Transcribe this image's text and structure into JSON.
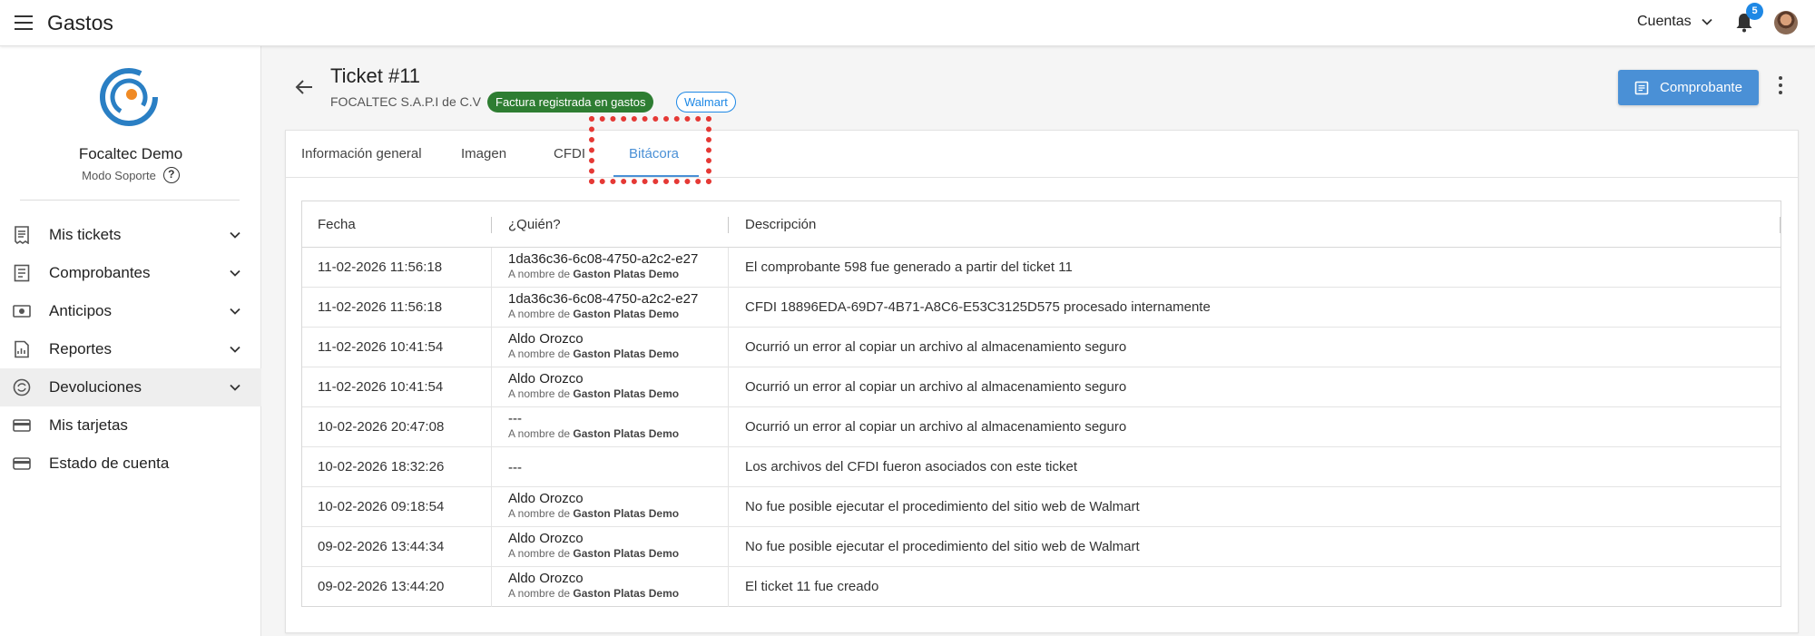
{
  "app": {
    "title": "Gastos"
  },
  "topbar": {
    "accounts_label": "Cuentas",
    "notifications_count": "5"
  },
  "sidebar": {
    "org_name": "Focaltec Demo",
    "org_mode": "Modo Soporte",
    "items": [
      {
        "label": "Mis tickets",
        "icon": "receipt-icon",
        "expandable": true
      },
      {
        "label": "Comprobantes",
        "icon": "document-icon",
        "expandable": true
      },
      {
        "label": "Anticipos",
        "icon": "cash-icon",
        "expandable": true
      },
      {
        "label": "Reportes",
        "icon": "report-icon",
        "expandable": true
      },
      {
        "label": "Devoluciones",
        "icon": "refund-icon",
        "expandable": true
      },
      {
        "label": "Mis tarjetas",
        "icon": "card-icon",
        "expandable": false
      },
      {
        "label": "Estado de cuenta",
        "icon": "wallet-icon",
        "expandable": false
      }
    ]
  },
  "ticket": {
    "title": "Ticket #11",
    "company": "FOCALTEC S.A.P.I de C.V",
    "status_badge": "Factura registrada en gastos",
    "store_badge": "Walmart",
    "comprobante_button": "Comprobante"
  },
  "tabs": [
    "Información general",
    "Imagen",
    "CFDI",
    "Bitácora"
  ],
  "log": {
    "headers": {
      "date": "Fecha",
      "who": "¿Quién?",
      "desc": "Descripción"
    },
    "on_behalf_prefix": "A nombre de",
    "rows": [
      {
        "date": "11-02-2026 11:56:18",
        "who": "1da36c36-6c08-4750-a2c2-e27",
        "on_behalf": "Gaston Platas Demo",
        "desc": "El comprobante 598 fue generado a partir del ticket 11"
      },
      {
        "date": "11-02-2026 11:56:18",
        "who": "1da36c36-6c08-4750-a2c2-e27",
        "on_behalf": "Gaston Platas Demo",
        "desc": "CFDI 18896EDA-69D7-4B71-A8C6-E53C3125D575 procesado internamente"
      },
      {
        "date": "11-02-2026 10:41:54",
        "who": "Aldo Orozco",
        "on_behalf": "Gaston Platas Demo",
        "desc": "Ocurrió un error al copiar un archivo al almacenamiento seguro"
      },
      {
        "date": "11-02-2026 10:41:54",
        "who": "Aldo Orozco",
        "on_behalf": "Gaston Platas Demo",
        "desc": "Ocurrió un error al copiar un archivo al almacenamiento seguro"
      },
      {
        "date": "10-02-2026 20:47:08",
        "who": "---",
        "on_behalf": "Gaston Platas Demo",
        "desc": "Ocurrió un error al copiar un archivo al almacenamiento seguro"
      },
      {
        "date": "10-02-2026 18:32:26",
        "who": "---",
        "on_behalf": "",
        "desc": "Los archivos del CFDI fueron asociados con este ticket"
      },
      {
        "date": "10-02-2026 09:18:54",
        "who": "Aldo Orozco",
        "on_behalf": "Gaston Platas Demo",
        "desc": "No fue posible ejecutar el procedimiento del sitio web de Walmart"
      },
      {
        "date": "09-02-2026 13:44:34",
        "who": "Aldo Orozco",
        "on_behalf": "Gaston Platas Demo",
        "desc": "No fue posible ejecutar el procedimiento del sitio web de Walmart"
      },
      {
        "date": "09-02-2026 13:44:20",
        "who": "Aldo Orozco",
        "on_behalf": "Gaston Platas Demo",
        "desc": "El ticket 11 fue creado"
      }
    ]
  },
  "colors": {
    "accent": "#4a90d6",
    "success": "#2e7d32",
    "highlight": "#e53935",
    "badge_blue": "#1e88e5"
  }
}
